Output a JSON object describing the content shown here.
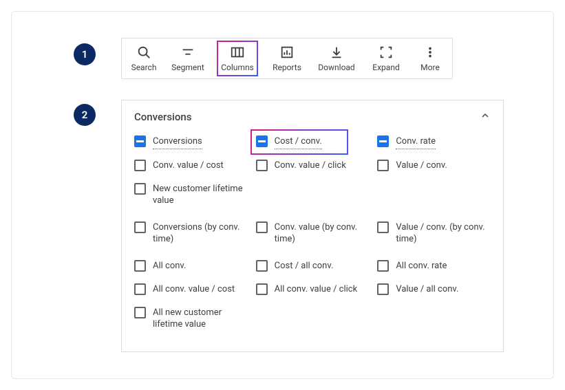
{
  "steps": {
    "one": "1",
    "two": "2"
  },
  "toolbar": {
    "search": "Search",
    "segment": "Segment",
    "columns": "Columns",
    "reports": "Reports",
    "download": "Download",
    "expand": "Expand",
    "more": "More"
  },
  "panel": {
    "title": "Conversions",
    "items": {
      "conversions": "Conversions",
      "cost_conv": "Cost / conv.",
      "conv_rate": "Conv. rate",
      "conv_value_cost": "Conv. value / cost",
      "conv_value_click": "Conv. value / click",
      "value_conv": "Value / conv.",
      "new_cust_ltv": "New customer lifetime value",
      "conv_by_time": "Conversions (by conv. time)",
      "conv_value_by_time": "Conv. value (by conv. time)",
      "value_conv_by_time": "Value / conv. (by conv. time)",
      "all_conv": "All conv.",
      "cost_all_conv": "Cost / all conv.",
      "all_conv_rate": "All conv. rate",
      "all_conv_value_cost": "All conv. value / cost",
      "all_conv_value_click": "All conv. value / click",
      "value_all_conv": "Value / all conv.",
      "all_new_cust_ltv": "All new customer lifetime value"
    }
  }
}
